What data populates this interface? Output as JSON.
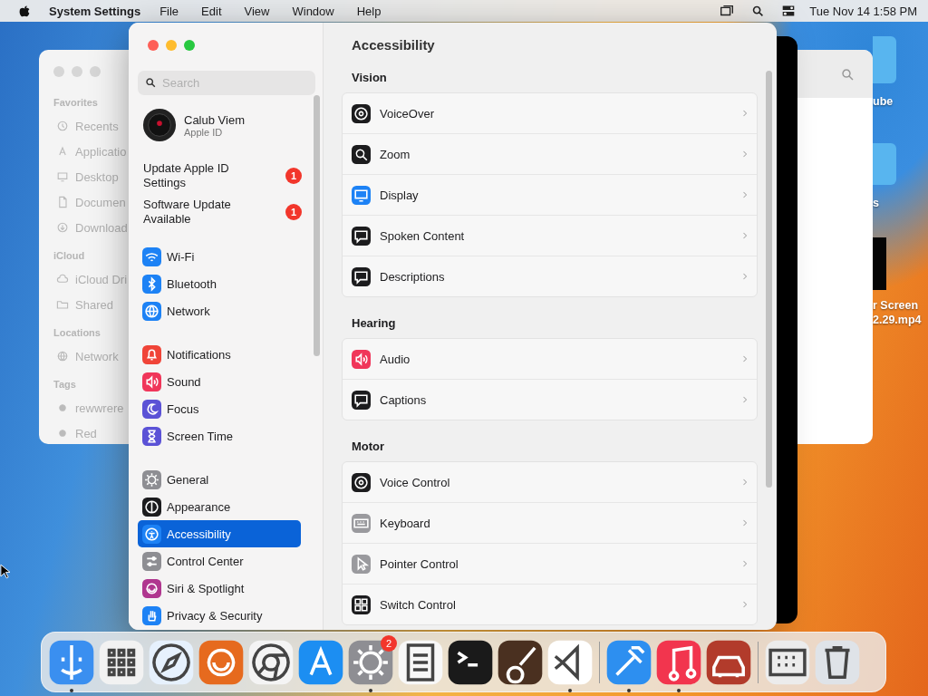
{
  "menubar": {
    "app": "System Settings",
    "menus": [
      "File",
      "Edit",
      "View",
      "Window",
      "Help"
    ],
    "clock": "Tue Nov 14  1:58 PM"
  },
  "finder_window": {
    "sections": [
      {
        "title": "Favorites",
        "items": [
          {
            "label": "Recents"
          },
          {
            "label": "Applicatio"
          },
          {
            "label": "Desktop"
          },
          {
            "label": "Documen"
          },
          {
            "label": "Download"
          }
        ]
      },
      {
        "title": "iCloud",
        "items": [
          {
            "label": "iCloud Dri"
          },
          {
            "label": "Shared"
          }
        ]
      },
      {
        "title": "Locations",
        "items": [
          {
            "label": "Network"
          }
        ]
      },
      {
        "title": "Tags",
        "items": [
          {
            "label": "rewwrere"
          },
          {
            "label": "Red"
          }
        ]
      }
    ]
  },
  "desktop_items": [
    {
      "kind": "folder",
      "lines": [
        "ube"
      ]
    },
    {
      "kind": "folder",
      "lines": [
        "s"
      ]
    },
    {
      "kind": "video",
      "lines": [
        "r Screen",
        "2.29.mp4"
      ]
    }
  ],
  "settings": {
    "title": "Accessibility",
    "sidebar": {
      "search": {
        "placeholder": "Search"
      },
      "account": {
        "name": "Calub Viem",
        "subtitle": "Apple ID"
      },
      "notices": [
        {
          "label": "Update Apple ID Settings",
          "badge": "1"
        },
        {
          "label": "Software Update Available",
          "badge": "1"
        }
      ],
      "groups": [
        [
          {
            "label": "Wi-Fi",
            "color": "#1d82f5",
            "selected": false
          },
          {
            "label": "Bluetooth",
            "color": "#1d82f5",
            "selected": false
          },
          {
            "label": "Network",
            "color": "#1d82f5",
            "selected": false
          }
        ],
        [
          {
            "label": "Notifications",
            "color": "#f04438",
            "selected": false
          },
          {
            "label": "Sound",
            "color": "#f0365a",
            "selected": false
          },
          {
            "label": "Focus",
            "color": "#5b52d6",
            "selected": false
          },
          {
            "label": "Screen Time",
            "color": "#5b52d6",
            "selected": false
          }
        ],
        [
          {
            "label": "General",
            "color": "#8e8e93",
            "selected": false
          },
          {
            "label": "Appearance",
            "color": "#1c1c1e",
            "selected": false
          },
          {
            "label": "Accessibility",
            "color": "#1d82f5",
            "selected": true
          },
          {
            "label": "Control Center",
            "color": "#8e8e93",
            "selected": false
          },
          {
            "label": "Siri & Spotlight",
            "color": "#b0368f",
            "selected": false
          },
          {
            "label": "Privacy & Security",
            "color": "#1d82f5",
            "selected": false
          }
        ]
      ]
    },
    "sections": [
      {
        "title": "Vision",
        "rows": [
          {
            "label": "VoiceOver",
            "color": "#1c1c1e"
          },
          {
            "label": "Zoom",
            "color": "#1c1c1e"
          },
          {
            "label": "Display",
            "color": "#1d82f5"
          },
          {
            "label": "Spoken Content",
            "color": "#1c1c1e"
          },
          {
            "label": "Descriptions",
            "color": "#1c1c1e"
          }
        ]
      },
      {
        "title": "Hearing",
        "rows": [
          {
            "label": "Audio",
            "color": "#f0365a"
          },
          {
            "label": "Captions",
            "color": "#1c1c1e"
          }
        ]
      },
      {
        "title": "Motor",
        "rows": [
          {
            "label": "Voice Control",
            "color": "#1c1c1e"
          },
          {
            "label": "Keyboard",
            "color": "#9a9a9e"
          },
          {
            "label": "Pointer Control",
            "color": "#9a9a9e"
          },
          {
            "label": "Switch Control",
            "color": "#1c1c1e"
          }
        ]
      }
    ]
  },
  "dock": {
    "items": [
      {
        "running": true
      },
      {
        "running": false
      },
      {
        "running": false
      },
      {
        "running": false
      },
      {
        "running": false
      },
      {
        "running": false
      },
      {
        "running": true,
        "badge": "2"
      },
      {
        "running": false
      },
      {
        "running": false
      },
      {
        "running": false
      },
      {
        "running": true
      },
      {
        "running": true
      },
      {
        "running": true
      },
      {
        "running": false
      },
      {
        "running": false
      },
      {
        "running": false
      }
    ]
  }
}
